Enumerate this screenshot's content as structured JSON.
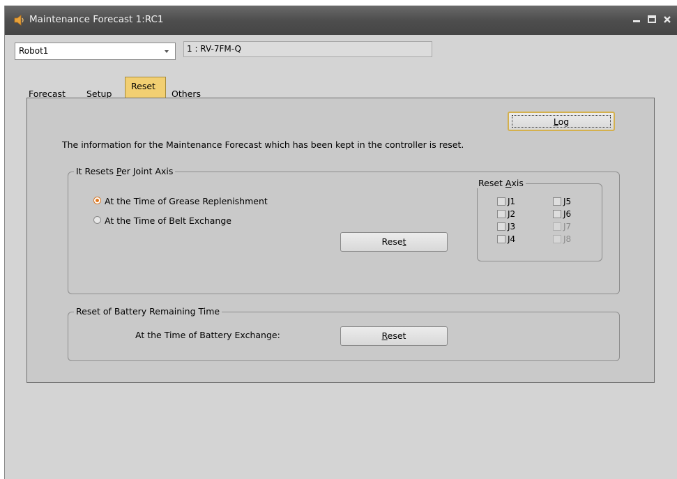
{
  "window": {
    "title": "Maintenance Forecast 1:RC1",
    "controls": [
      "minimize-icon",
      "maximize-icon",
      "close-icon"
    ]
  },
  "robot_select": {
    "value": "Robot1"
  },
  "model_field": {
    "value": "1 : RV-7FM-Q"
  },
  "tabs": [
    {
      "label": "Forecast",
      "active": false
    },
    {
      "label": "Setup",
      "active": false
    },
    {
      "label": "Reset",
      "active": true
    },
    {
      "label": "Others",
      "active": false
    }
  ],
  "reset_tab": {
    "log_button": {
      "pre": "",
      "key": "L",
      "post": "og"
    },
    "description": "The information for the Maintenance Forecast which has been kept in the controller is reset.",
    "per_joint_group": {
      "legend_pre": "It Resets ",
      "legend_key": "P",
      "legend_post": "er Joint Axis",
      "radio_options": [
        {
          "label": "At the Time of Grease Replenishment",
          "selected": true
        },
        {
          "label": "At the Time of Belt Exchange",
          "selected": false
        }
      ],
      "reset_button": {
        "pre": "Rese",
        "key": "t",
        "post": ""
      },
      "reset_axis_group": {
        "legend_pre": "Reset ",
        "legend_key": "A",
        "legend_post": "xis",
        "axes": [
          {
            "label": "J1",
            "enabled": true,
            "checked": false
          },
          {
            "label": "J2",
            "enabled": true,
            "checked": false
          },
          {
            "label": "J3",
            "enabled": true,
            "checked": false
          },
          {
            "label": "J4",
            "enabled": true,
            "checked": false
          },
          {
            "label": "J5",
            "enabled": true,
            "checked": false
          },
          {
            "label": "J6",
            "enabled": true,
            "checked": false
          },
          {
            "label": "J7",
            "enabled": false,
            "checked": false
          },
          {
            "label": "J8",
            "enabled": false,
            "checked": false
          }
        ]
      }
    },
    "battery_group": {
      "legend": "Reset of Battery Remaining Time",
      "label": "At the Time of Battery Exchange:",
      "reset_button": {
        "pre": "",
        "key": "R",
        "post": "eset"
      }
    }
  },
  "colors": {
    "title_bar": "#4e4e4e",
    "active_tab": "#f2cf72",
    "radio_selected": "#e0781e",
    "window_bg": "#d4d4d4"
  }
}
